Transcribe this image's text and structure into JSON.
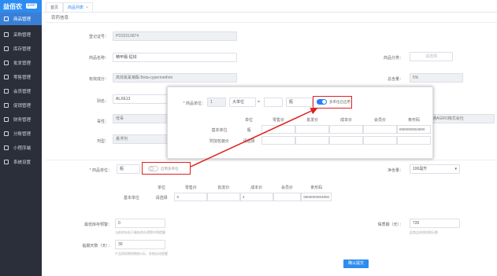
{
  "app": {
    "brand": "益佰农",
    "badge": "ERP"
  },
  "sidebar": {
    "items": [
      {
        "label": "商品管理"
      },
      {
        "label": "采购管理"
      },
      {
        "label": "库存管理"
      },
      {
        "label": "批发管理"
      },
      {
        "label": "零售管理"
      },
      {
        "label": "会员管理"
      },
      {
        "label": "促销管理"
      },
      {
        "label": "财务管理"
      },
      {
        "label": "分账管理"
      },
      {
        "label": "小程序端"
      },
      {
        "label": "系统设置"
      }
    ]
  },
  "tabs": [
    {
      "label": "首页"
    },
    {
      "label": "商品列表",
      "close": "×"
    }
  ],
  "section": {
    "title": "农药信息"
  },
  "form": {
    "reg_no": {
      "label": "登记证号：",
      "value": "PD20210874"
    },
    "product_name": {
      "label": "商品名称：",
      "value": "精甲霜·锰锌"
    },
    "category": {
      "label": "商品分类：",
      "placeholder": "请选择"
    },
    "ingredients": {
      "label": "有效成分：",
      "value": "高效氯氰菊酯 Beta-cypermethrin"
    },
    "total_content": {
      "label": "总含量：",
      "value": "5%"
    },
    "aliases": {
      "label": "别名：",
      "value": "ALXE13"
    },
    "poison": {
      "label": "毒性：",
      "value": "低毒"
    },
    "producer": {
      "value": "南通AGRO株式会社"
    },
    "dosage": {
      "label": "剂型：",
      "value": "悬浮剂"
    },
    "unit": {
      "label": "商品单位：",
      "value": "瓶",
      "toggle_label": "启用多单位"
    },
    "spec": {
      "label": "净含量：",
      "value": "100毫升"
    },
    "min_stock": {
      "label": "最低库存预警：",
      "value": "0",
      "hint": "当前库存低于最低库存预警时将提醒"
    },
    "shelf_life": {
      "label": "保质期（天）：",
      "value": "720",
      "hint": "此商品的保质期天数"
    },
    "expire_days": {
      "label": "临期天数（天）：",
      "value": "30",
      "hint": "产品保质期到期前N天，系统自动提醒"
    },
    "submit": "确认提交"
  },
  "price_table": {
    "headers": [
      "单位",
      "零售价",
      "批发价",
      "成本价",
      "会员价",
      "条形码"
    ],
    "row_label": "基本单位",
    "row": [
      "请选择",
      "6",
      "",
      "4",
      "",
      "6900000004800"
    ]
  },
  "popup": {
    "unit_label": "商品单位：",
    "qty": "1",
    "big_unit": "大单位",
    "eq": "=",
    "small_qty": "",
    "small_unit": "瓶",
    "toggle_label": "多单位已启用",
    "headers": [
      "单位",
      "零售价",
      "批发价",
      "成本价",
      "会员价",
      "条形码"
    ],
    "rows": [
      {
        "label": "基本单位",
        "unit": "瓶",
        "retail": "",
        "wholesale": "",
        "cost": "",
        "member": "",
        "barcode": "6900000004800"
      },
      {
        "label": "附加包装价",
        "unit": "请选择",
        "retail": "",
        "wholesale": "",
        "cost": "",
        "member": "",
        "barcode": ""
      }
    ]
  },
  "colors": {
    "accent": "#2d8cf0",
    "sidebar": "#2b2f3a",
    "arrow": "#e02020"
  }
}
